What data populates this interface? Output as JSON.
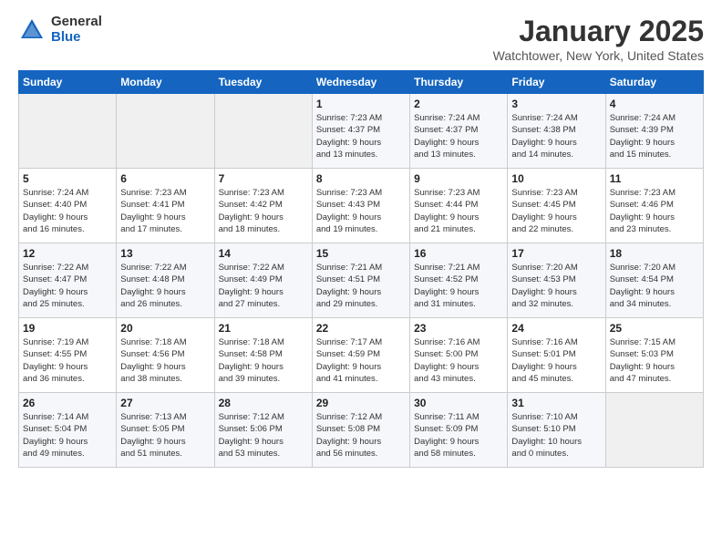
{
  "logo": {
    "general": "General",
    "blue": "Blue"
  },
  "title": "January 2025",
  "location": "Watchtower, New York, United States",
  "days_of_week": [
    "Sunday",
    "Monday",
    "Tuesday",
    "Wednesday",
    "Thursday",
    "Friday",
    "Saturday"
  ],
  "weeks": [
    [
      {
        "day": "",
        "info": ""
      },
      {
        "day": "",
        "info": ""
      },
      {
        "day": "",
        "info": ""
      },
      {
        "day": "1",
        "info": "Sunrise: 7:23 AM\nSunset: 4:37 PM\nDaylight: 9 hours\nand 13 minutes."
      },
      {
        "day": "2",
        "info": "Sunrise: 7:24 AM\nSunset: 4:37 PM\nDaylight: 9 hours\nand 13 minutes."
      },
      {
        "day": "3",
        "info": "Sunrise: 7:24 AM\nSunset: 4:38 PM\nDaylight: 9 hours\nand 14 minutes."
      },
      {
        "day": "4",
        "info": "Sunrise: 7:24 AM\nSunset: 4:39 PM\nDaylight: 9 hours\nand 15 minutes."
      }
    ],
    [
      {
        "day": "5",
        "info": "Sunrise: 7:24 AM\nSunset: 4:40 PM\nDaylight: 9 hours\nand 16 minutes."
      },
      {
        "day": "6",
        "info": "Sunrise: 7:23 AM\nSunset: 4:41 PM\nDaylight: 9 hours\nand 17 minutes."
      },
      {
        "day": "7",
        "info": "Sunrise: 7:23 AM\nSunset: 4:42 PM\nDaylight: 9 hours\nand 18 minutes."
      },
      {
        "day": "8",
        "info": "Sunrise: 7:23 AM\nSunset: 4:43 PM\nDaylight: 9 hours\nand 19 minutes."
      },
      {
        "day": "9",
        "info": "Sunrise: 7:23 AM\nSunset: 4:44 PM\nDaylight: 9 hours\nand 21 minutes."
      },
      {
        "day": "10",
        "info": "Sunrise: 7:23 AM\nSunset: 4:45 PM\nDaylight: 9 hours\nand 22 minutes."
      },
      {
        "day": "11",
        "info": "Sunrise: 7:23 AM\nSunset: 4:46 PM\nDaylight: 9 hours\nand 23 minutes."
      }
    ],
    [
      {
        "day": "12",
        "info": "Sunrise: 7:22 AM\nSunset: 4:47 PM\nDaylight: 9 hours\nand 25 minutes."
      },
      {
        "day": "13",
        "info": "Sunrise: 7:22 AM\nSunset: 4:48 PM\nDaylight: 9 hours\nand 26 minutes."
      },
      {
        "day": "14",
        "info": "Sunrise: 7:22 AM\nSunset: 4:49 PM\nDaylight: 9 hours\nand 27 minutes."
      },
      {
        "day": "15",
        "info": "Sunrise: 7:21 AM\nSunset: 4:51 PM\nDaylight: 9 hours\nand 29 minutes."
      },
      {
        "day": "16",
        "info": "Sunrise: 7:21 AM\nSunset: 4:52 PM\nDaylight: 9 hours\nand 31 minutes."
      },
      {
        "day": "17",
        "info": "Sunrise: 7:20 AM\nSunset: 4:53 PM\nDaylight: 9 hours\nand 32 minutes."
      },
      {
        "day": "18",
        "info": "Sunrise: 7:20 AM\nSunset: 4:54 PM\nDaylight: 9 hours\nand 34 minutes."
      }
    ],
    [
      {
        "day": "19",
        "info": "Sunrise: 7:19 AM\nSunset: 4:55 PM\nDaylight: 9 hours\nand 36 minutes."
      },
      {
        "day": "20",
        "info": "Sunrise: 7:18 AM\nSunset: 4:56 PM\nDaylight: 9 hours\nand 38 minutes."
      },
      {
        "day": "21",
        "info": "Sunrise: 7:18 AM\nSunset: 4:58 PM\nDaylight: 9 hours\nand 39 minutes."
      },
      {
        "day": "22",
        "info": "Sunrise: 7:17 AM\nSunset: 4:59 PM\nDaylight: 9 hours\nand 41 minutes."
      },
      {
        "day": "23",
        "info": "Sunrise: 7:16 AM\nSunset: 5:00 PM\nDaylight: 9 hours\nand 43 minutes."
      },
      {
        "day": "24",
        "info": "Sunrise: 7:16 AM\nSunset: 5:01 PM\nDaylight: 9 hours\nand 45 minutes."
      },
      {
        "day": "25",
        "info": "Sunrise: 7:15 AM\nSunset: 5:03 PM\nDaylight: 9 hours\nand 47 minutes."
      }
    ],
    [
      {
        "day": "26",
        "info": "Sunrise: 7:14 AM\nSunset: 5:04 PM\nDaylight: 9 hours\nand 49 minutes."
      },
      {
        "day": "27",
        "info": "Sunrise: 7:13 AM\nSunset: 5:05 PM\nDaylight: 9 hours\nand 51 minutes."
      },
      {
        "day": "28",
        "info": "Sunrise: 7:12 AM\nSunset: 5:06 PM\nDaylight: 9 hours\nand 53 minutes."
      },
      {
        "day": "29",
        "info": "Sunrise: 7:12 AM\nSunset: 5:08 PM\nDaylight: 9 hours\nand 56 minutes."
      },
      {
        "day": "30",
        "info": "Sunrise: 7:11 AM\nSunset: 5:09 PM\nDaylight: 9 hours\nand 58 minutes."
      },
      {
        "day": "31",
        "info": "Sunrise: 7:10 AM\nSunset: 5:10 PM\nDaylight: 10 hours\nand 0 minutes."
      },
      {
        "day": "",
        "info": ""
      }
    ]
  ]
}
